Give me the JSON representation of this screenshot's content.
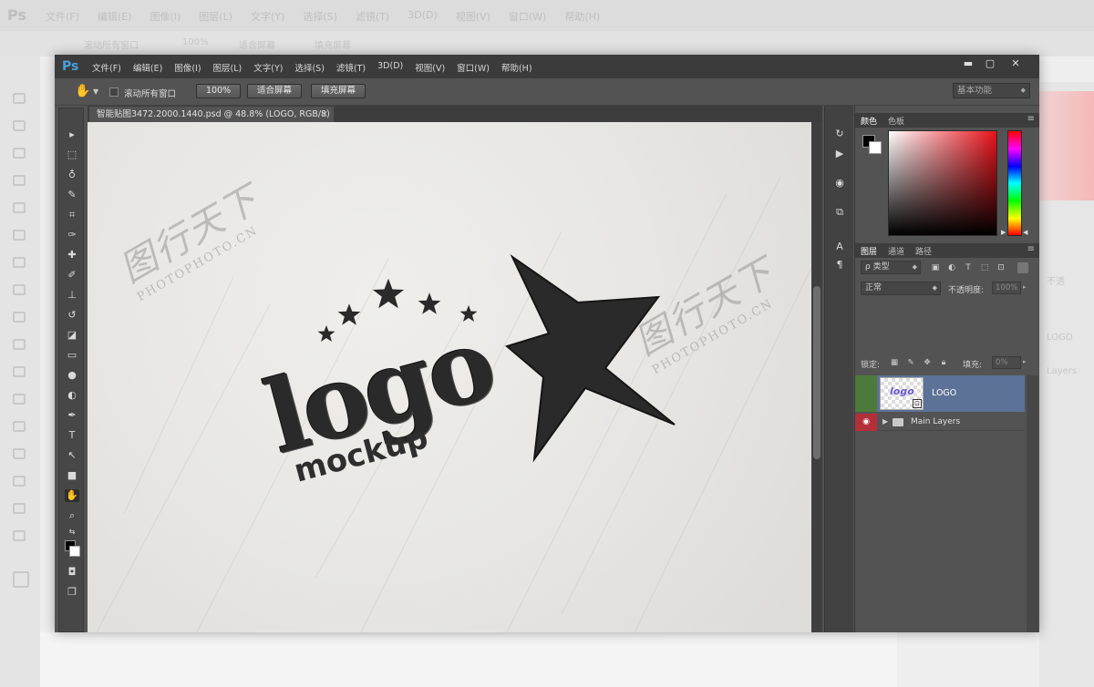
{
  "app": {
    "logo": "Ps"
  },
  "menu": [
    "文件(F)",
    "编辑(E)",
    "图像(I)",
    "图层(L)",
    "文字(Y)",
    "选择(S)",
    "滤镜(T)",
    "3D(D)",
    "视图(V)",
    "窗口(W)",
    "帮助(H)"
  ],
  "window_controls": {
    "minimize": "▬",
    "maximize": "▢",
    "close": "✕"
  },
  "options_bar": {
    "scroll_all_windows": "滚动所有窗口",
    "zoom_100": "100%",
    "fit_screen": "适合屏幕",
    "fill_screen": "填充屏幕",
    "workspace": "基本功能"
  },
  "document": {
    "tab_title": "智能贴图3472.2000.1440.psd @ 48.8% (LOGO, RGB/8)",
    "tab_close": "×",
    "artwork": {
      "logo_word": "logo",
      "mockup_word": "mockup"
    },
    "watermark": {
      "cn": "图行天下",
      "en": "PHOTOPHOTO.CN"
    }
  },
  "color_panel": {
    "tabs": [
      "颜色",
      "色板"
    ],
    "foreground": "#000000",
    "background": "#ffffff",
    "accent_red": "#e8121a"
  },
  "layers_panel": {
    "tabs": [
      "图层",
      "通道",
      "路径"
    ],
    "filter_kind": "ρ 类型",
    "blend_mode": "正常",
    "opacity_label": "不透明度:",
    "opacity_value": "100%",
    "lock_label": "锁定:",
    "fill_label": "填充:",
    "fill_value": "0%",
    "layers": [
      {
        "name": "LOGO",
        "thumb_text": "logo",
        "selected": true
      },
      {
        "name": "Main Layers",
        "type": "group"
      }
    ]
  },
  "background_ghost": {
    "logo": "Ps",
    "menu": [
      "文件(F)",
      "编辑(E)",
      "图像(I)",
      "图层(L)",
      "文字(Y)",
      "选择(S)",
      "滤镜(T)",
      "3D(D)",
      "视图(V)",
      "窗口(W)",
      "帮助(H)"
    ],
    "opts": [
      "滚动所有窗口",
      "100%",
      "适合屏幕",
      "填充屏幕"
    ],
    "right_texts": [
      "不透",
      "LOGO",
      "Layers"
    ]
  }
}
